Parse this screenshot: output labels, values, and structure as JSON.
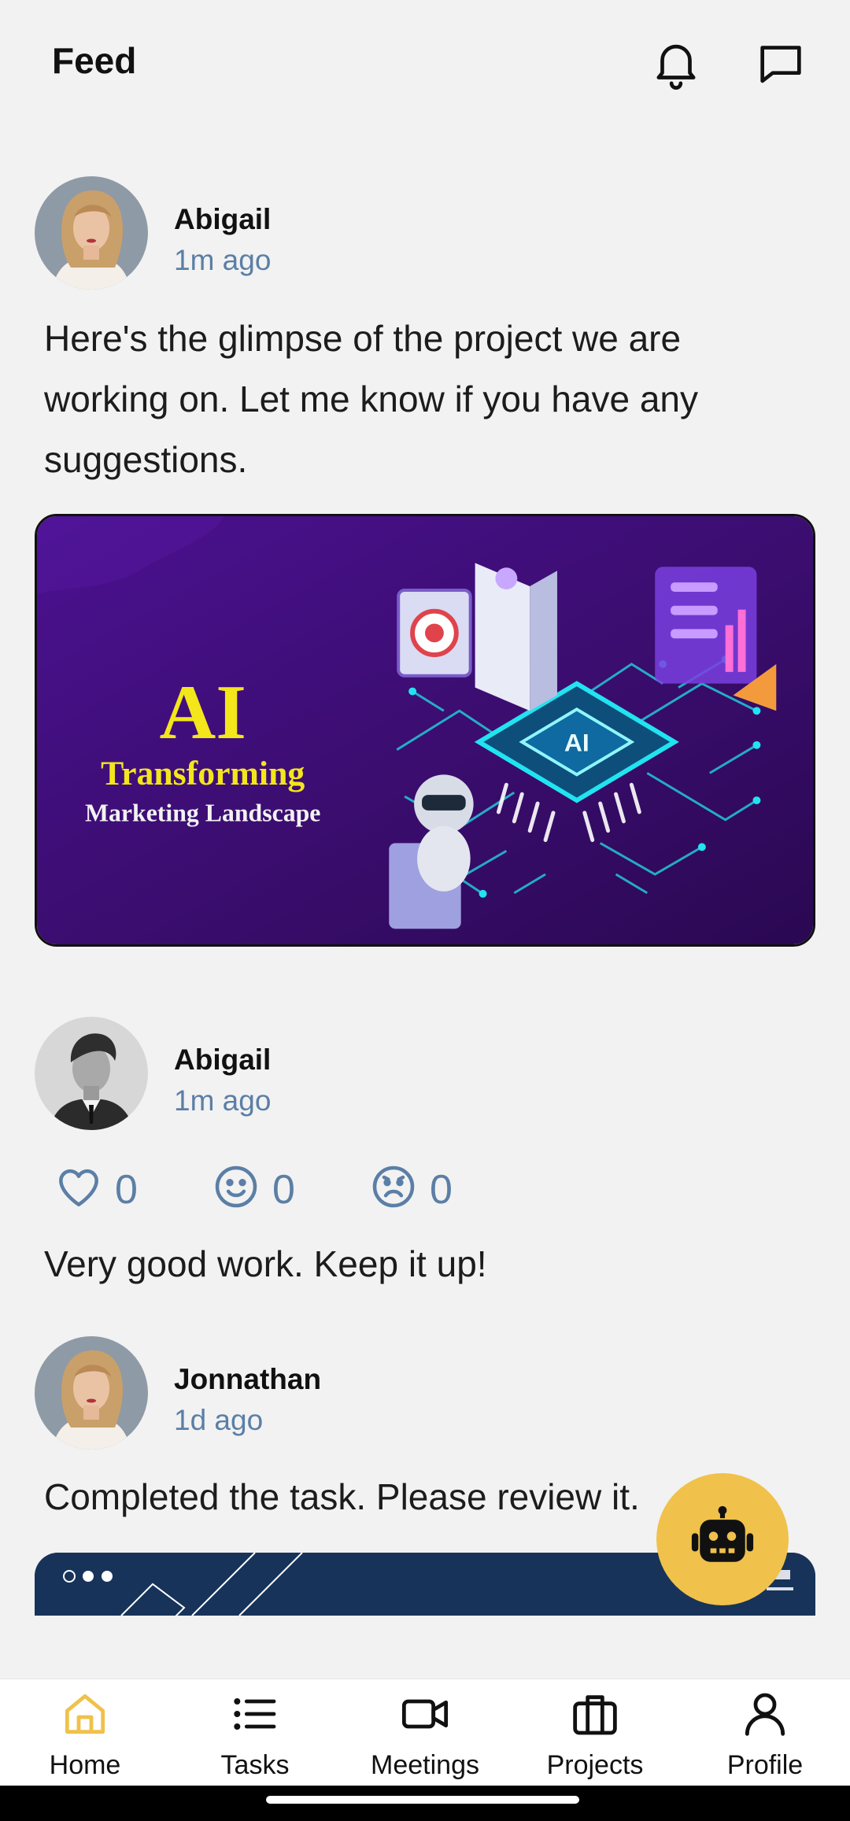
{
  "header": {
    "title": "Feed",
    "notifications_icon": "bell-icon",
    "messages_icon": "chat-bubble-icon"
  },
  "posts": [
    {
      "author": "Abigail",
      "time": "1m ago",
      "text": "Here's the glimpse of the project we are working on. Let me know if you have any suggestions.",
      "image": {
        "headline": "AI",
        "line1": "Transforming",
        "line2": "Marketing Landscape",
        "chip_label": "AI"
      }
    },
    {
      "author": "Abigail",
      "time": "1m ago",
      "reactions": [
        {
          "icon": "heart-icon",
          "count": "0"
        },
        {
          "icon": "smile-icon",
          "count": "0"
        },
        {
          "icon": "sad-icon",
          "count": "0"
        }
      ],
      "text": "Very good work. Keep it up!"
    },
    {
      "author": "Jonnathan",
      "time": "1d ago",
      "text": "Completed the task. Please review it."
    }
  ],
  "fab": {
    "icon": "robot-icon"
  },
  "bottom_nav": [
    {
      "label": "Home",
      "icon": "home-icon",
      "active": true
    },
    {
      "label": "Tasks",
      "icon": "list-icon",
      "active": false
    },
    {
      "label": "Meetings",
      "icon": "video-camera-icon",
      "active": false
    },
    {
      "label": "Projects",
      "icon": "briefcase-icon",
      "active": false
    },
    {
      "label": "Profile",
      "icon": "person-icon",
      "active": false
    }
  ],
  "colors": {
    "background": "#f2f2f2",
    "accent": "#f0c14b",
    "muted_text": "#5b7fa6",
    "image_purple": "#3a0d6e"
  }
}
